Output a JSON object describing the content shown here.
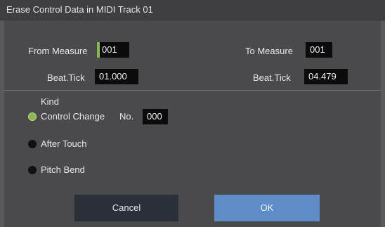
{
  "dialog": {
    "title": "Erase Control Data in MIDI Track 01"
  },
  "from": {
    "measure_label": "From Measure",
    "measure_value": "001",
    "beat_label": "Beat.Tick",
    "beat_value": "01.000"
  },
  "to": {
    "measure_label": "To Measure",
    "measure_value": "001",
    "beat_label": "Beat.Tick",
    "beat_value": "04.479"
  },
  "kind": {
    "label": "Kind",
    "options": [
      {
        "label": "Control Change",
        "selected": true
      },
      {
        "label": "After Touch",
        "selected": false
      },
      {
        "label": "Pitch Bend",
        "selected": false
      }
    ],
    "number_label": "No.",
    "number_value": "000"
  },
  "buttons": {
    "cancel": "Cancel",
    "ok": "OK"
  },
  "colors": {
    "accent_green": "#8bb850",
    "ok_blue": "#5d8cc7"
  }
}
